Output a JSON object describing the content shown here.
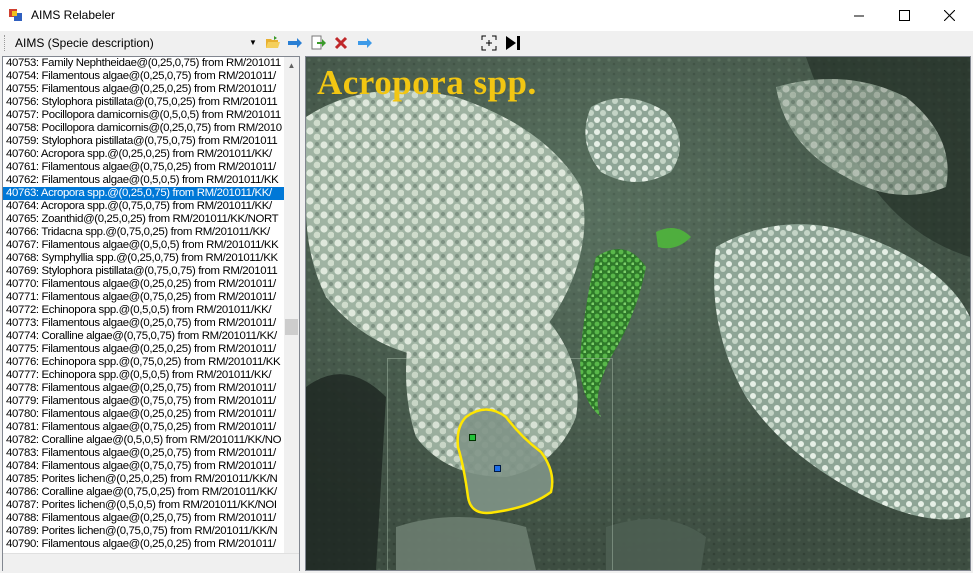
{
  "window": {
    "title": "AIMS Relabeler",
    "minimize": "—",
    "maximize": "☐",
    "close": "✕"
  },
  "toolbar": {
    "dataset_select": "AIMS (Specie description)",
    "buttons": [
      "open-folder-icon",
      "next-arrow-icon",
      "export-icon",
      "delete-icon",
      "forward-icon",
      "crosshair-icon",
      "skip-end-icon"
    ]
  },
  "list": {
    "selected_index": 10,
    "items": [
      "40753: Family Nephtheidae@(0,25,0,75) from RM/201011",
      "40754: Filamentous algae@(0,25,0,75) from RM/201011/",
      "40755: Filamentous algae@(0,25,0,25) from RM/201011/",
      "40756: Stylophora pistillata@(0,75,0,25) from RM/201011",
      "40757: Pocillopora damicornis@(0,5,0,5) from RM/201011",
      "40758: Pocillopora damicornis@(0,25,0,75) from RM/2010",
      "40759: Stylophora pistillata@(0,75,0,75) from RM/201011",
      "40760: Acropora spp.@(0,25,0,25) from RM/201011/KK/",
      "40761: Filamentous algae@(0,75,0,25) from RM/201011/",
      "40762: Filamentous algae@(0,5,0,5) from RM/201011/KK",
      "40763: Acropora spp.@(0,25,0,75) from RM/201011/KK/",
      "40764: Acropora spp.@(0,75,0,75) from RM/201011/KK/",
      "40765: Zoanthid@(0,25,0,25) from RM/201011/KK/NORT",
      "40766: Tridacna spp.@(0,75,0,25) from RM/201011/KK/",
      "40767: Filamentous algae@(0,5,0,5) from RM/201011/KK",
      "40768: Symphyllia spp.@(0,25,0,75) from RM/201011/KK",
      "40769: Stylophora pistillata@(0,75,0,75) from RM/201011",
      "40770: Filamentous algae@(0,25,0,25) from RM/201011/",
      "40771: Filamentous algae@(0,75,0,25) from RM/201011/",
      "40772: Echinopora spp.@(0,5,0,5) from RM/201011/KK/",
      "40773: Filamentous algae@(0,25,0,75) from RM/201011/",
      "40774: Coralline algae@(0,75,0,75) from RM/201011/KK/",
      "40775: Filamentous algae@(0,25,0,25) from RM/201011/",
      "40776: Echinopora spp.@(0,75,0,25) from RM/201011/KK",
      "40777: Echinopora spp.@(0,5,0,5) from RM/201011/KK/",
      "40778: Filamentous algae@(0,25,0,75) from RM/201011/",
      "40779: Filamentous algae@(0,75,0,75) from RM/201011/",
      "40780: Filamentous algae@(0,25,0,25) from RM/201011/",
      "40781: Filamentous algae@(0,75,0,25) from RM/201011/",
      "40782: Coralline algae@(0,5,0,5) from RM/201011/KK/NO",
      "40783: Filamentous algae@(0,25,0,75) from RM/201011/",
      "40784: Filamentous algae@(0,75,0,75) from RM/201011/",
      "40785: Porites lichen@(0,25,0,25) from RM/201011/KK/N",
      "40786: Coralline algae@(0,75,0,25) from RM/201011/KK/",
      "40787: Porites lichen@(0,5,0,5) from RM/201011/KK/NOI",
      "40788: Filamentous algae@(0,25,0,75) from RM/201011/",
      "40789: Porites lichen@(0,75,0,75) from RM/201011/KK/N",
      "40790: Filamentous algae@(0,25,0,25) from RM/201011/"
    ]
  },
  "image": {
    "label": "Acropora spp.",
    "label_color": "#f2c612",
    "outline_color": "#ffe600"
  }
}
